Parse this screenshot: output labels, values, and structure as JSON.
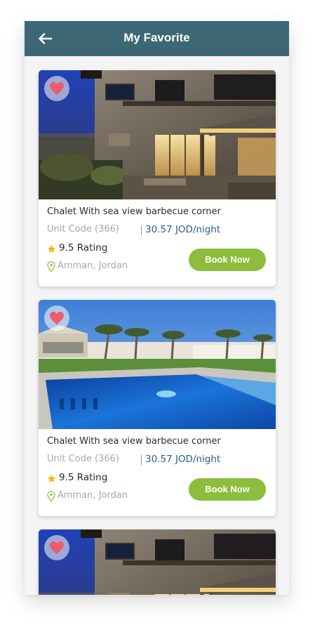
{
  "header": {
    "title": "My Favorite",
    "back_icon": "arrow-left-icon",
    "background_color": "#3d6775"
  },
  "favorites": [
    {
      "image": "chalet-night-exterior",
      "favorite_icon": "heart-icon",
      "title": "Chalet With sea view barbecue corner",
      "unit_code": "Unit Code (366)",
      "price": "30.57 JOD/night",
      "rating": "9.5 Rating",
      "location": "Amman, Jordan",
      "book_label": "Book Now"
    },
    {
      "image": "chalet-pool-palms",
      "favorite_icon": "heart-icon",
      "title": "Chalet With sea view barbecue corner",
      "unit_code": "Unit Code (366)",
      "price": "30.57 JOD/night",
      "rating": "9.5 Rating",
      "location": "Amman, Jordan",
      "book_label": "Book Now"
    },
    {
      "image": "chalet-night-exterior",
      "favorite_icon": "heart-icon"
    }
  ],
  "colors": {
    "accent_green": "#8cbd3c",
    "price_blue": "#2f5d8c",
    "heart": "#ef5b6c",
    "star": "#f2b705"
  }
}
